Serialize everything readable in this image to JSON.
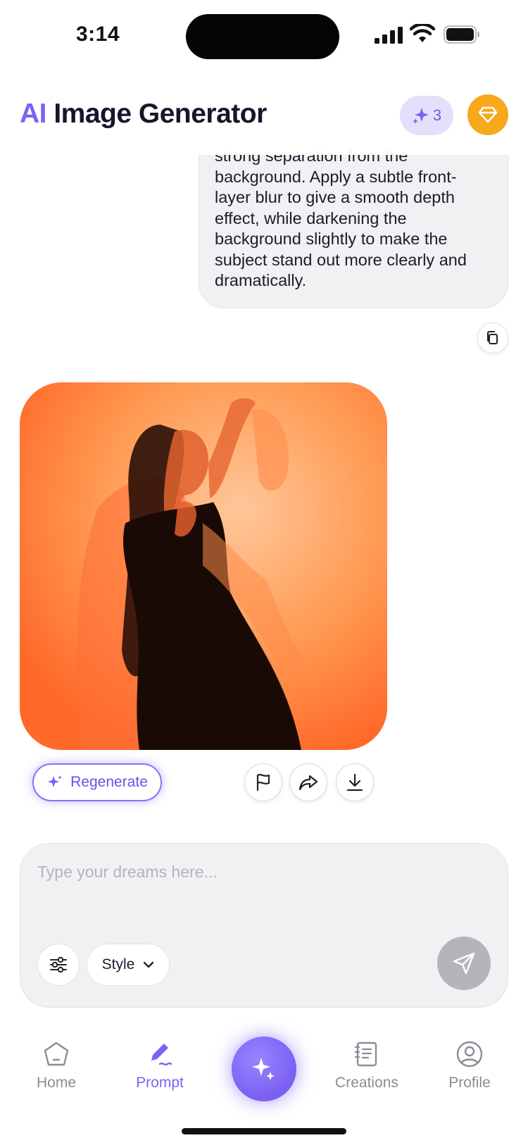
{
  "status_bar": {
    "time": "3:14"
  },
  "header": {
    "title_accent": "AI",
    "title_rest": " Image Generator",
    "credits_count": "3"
  },
  "prompt": {
    "lines": [
      "strong separation from the",
      "background. Apply a subtle front-",
      "layer blur to give a smooth depth",
      "effect, while darkening the",
      "background slightly to make the",
      "subject stand out more clearly and",
      "dramatically."
    ]
  },
  "image_actions": {
    "regenerate_label": "Regenerate"
  },
  "composer": {
    "placeholder": "Type your dreams here...",
    "style_label": "Style"
  },
  "tabs": [
    {
      "label": "Home"
    },
    {
      "label": "Prompt"
    },
    {
      "label": "Creations"
    },
    {
      "label": "Profile"
    }
  ],
  "colors": {
    "accent": "#7b62f5",
    "premium": "#f7a81b",
    "image_orange": "#ff7a2e"
  },
  "icons": {
    "credits": "sparkle-icon",
    "premium": "diamond-icon",
    "copy": "copy-icon",
    "flag": "flag-icon",
    "share": "share-icon",
    "download": "download-icon",
    "filters": "sliders-icon",
    "send": "send-icon",
    "home": "home-icon",
    "prompt": "pen-icon",
    "create": "sparkle-icon",
    "creations": "gallery-icon",
    "profile": "user-icon"
  }
}
